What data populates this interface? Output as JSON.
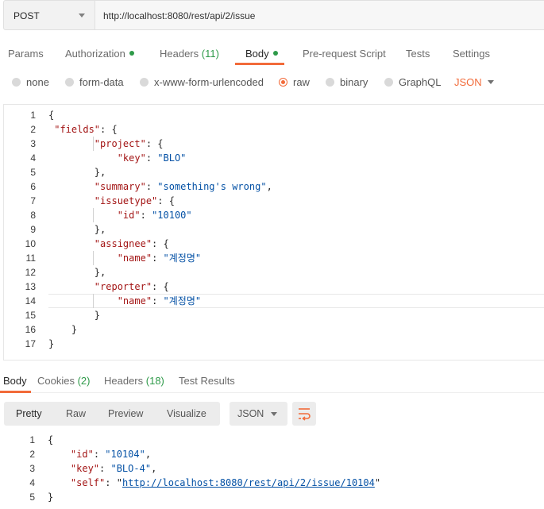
{
  "request": {
    "method": "POST",
    "url": "http://localhost:8080/rest/api/2/issue"
  },
  "request_tabs": [
    {
      "label": "Params",
      "count": "",
      "dot": false
    },
    {
      "label": "Authorization",
      "count": "",
      "dot": true
    },
    {
      "label": "Headers",
      "count": "(11)",
      "dot": false
    },
    {
      "label": "Body",
      "count": "",
      "dot": true,
      "active": true
    },
    {
      "label": "Pre-request Script",
      "count": "",
      "dot": false
    },
    {
      "label": "Tests",
      "count": "",
      "dot": false
    },
    {
      "label": "Settings",
      "count": "",
      "dot": false
    }
  ],
  "body_types": [
    "none",
    "form-data",
    "x-www-form-urlencoded",
    "raw",
    "binary",
    "GraphQL"
  ],
  "body_type_selected": "raw",
  "body_language": "JSON",
  "editor": {
    "line_numbers": [
      "1",
      "2",
      "3",
      "4",
      "5",
      "6",
      "7",
      "8",
      "9",
      "10",
      "11",
      "12",
      "13",
      "14",
      "15",
      "16",
      "17"
    ],
    "lines": [
      "{",
      " \"fields\": {",
      "        \"project\": {",
      "            \"key\": \"BLO\"",
      "        },",
      "        \"summary\": \"something's wrong\",",
      "        \"issuetype\": {",
      "            \"id\": \"10100\"",
      "        },",
      "        \"assignee\": {",
      "            \"name\": \"계정명\"",
      "        },",
      "        \"reporter\": {",
      "            \"name\": \"계정명\"",
      "        }",
      "    }",
      "}"
    ]
  },
  "response_tabs": [
    {
      "label": "Body",
      "count": "",
      "active": true
    },
    {
      "label": "Cookies",
      "count": "(2)"
    },
    {
      "label": "Headers",
      "count": "(18)"
    },
    {
      "label": "Test Results",
      "count": ""
    }
  ],
  "view_modes": [
    "Pretty",
    "Raw",
    "Preview",
    "Visualize"
  ],
  "view_mode_selected": "Pretty",
  "response_format": "JSON",
  "icons": {
    "wrap": "wrap-lines-icon",
    "method_caret": "chevron-down-icon"
  },
  "colors": {
    "accent": "#f26b3a",
    "green": "#2e9a49",
    "key": "#a31515",
    "string": "#0451a5"
  },
  "response": {
    "line_numbers": [
      "1",
      "2",
      "3",
      "4",
      "5"
    ],
    "lines": [
      "{",
      "    \"id\": \"10104\",",
      "    \"key\": \"BLO-4\",",
      "    \"self\": \"http://localhost:8080/rest/api/2/issue/10104\"",
      "}"
    ]
  }
}
